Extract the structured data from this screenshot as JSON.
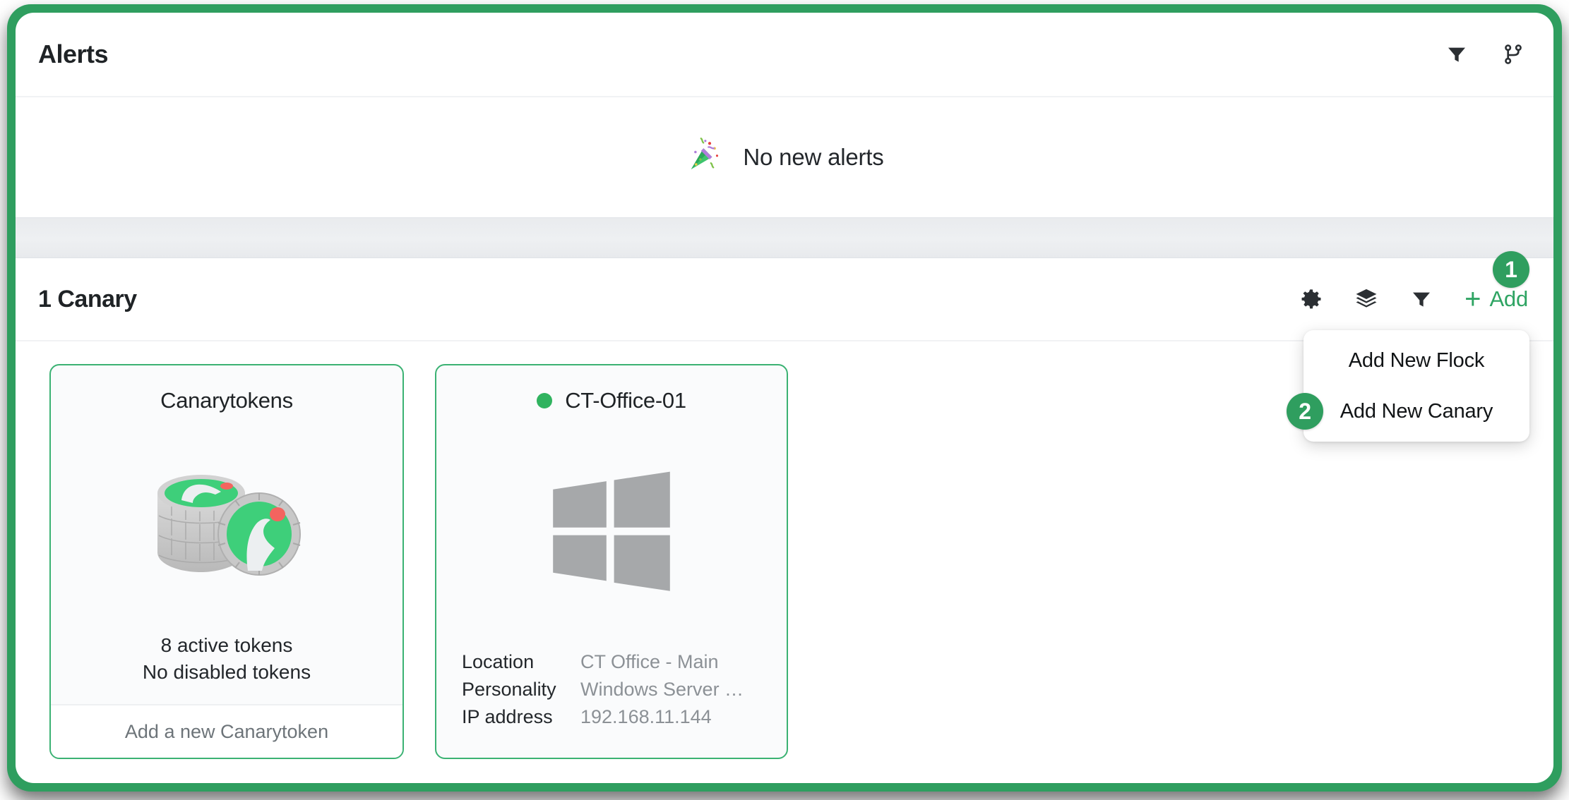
{
  "alerts": {
    "title": "Alerts",
    "empty_text": "No new alerts",
    "empty_icon": "party-popper-emoji",
    "icons": [
      {
        "name": "filter-icon",
        "label": "Filter"
      },
      {
        "name": "flock-branch-icon",
        "label": "Flocks"
      }
    ]
  },
  "canary_section": {
    "count_label": "1 Canary",
    "toolbar_icons": [
      {
        "name": "gear-icon",
        "label": "Settings"
      },
      {
        "name": "layers-icon",
        "label": "Layers"
      },
      {
        "name": "filter-icon",
        "label": "Filter"
      }
    ],
    "add_button": {
      "plus": "+",
      "label": "Add",
      "badge": "1"
    },
    "dropdown": {
      "items": [
        {
          "label": "Add New Flock",
          "badge": ""
        },
        {
          "label": "Add New Canary",
          "badge": "2"
        }
      ]
    }
  },
  "cards": {
    "canarytokens": {
      "title": "Canarytokens",
      "art": "canarytoken-coins-illustration",
      "active_tokens": "8 active tokens",
      "disabled_tokens": "No disabled tokens",
      "footer_action": "Add a new Canarytoken"
    },
    "device": {
      "name": "CT-Office-01",
      "status": "online",
      "art": "windows-logo-icon",
      "meta": [
        {
          "key": "Location",
          "value": "CT Office - Main"
        },
        {
          "key": "Personality",
          "value": "Windows Server …"
        },
        {
          "key": "IP address",
          "value": "192.168.11.144"
        }
      ]
    }
  },
  "colors": {
    "brand_green": "#2f9e5f",
    "accent_green": "#3bb273",
    "card_bg": "#fafbfc",
    "divider_gray": "#eef0f2"
  }
}
